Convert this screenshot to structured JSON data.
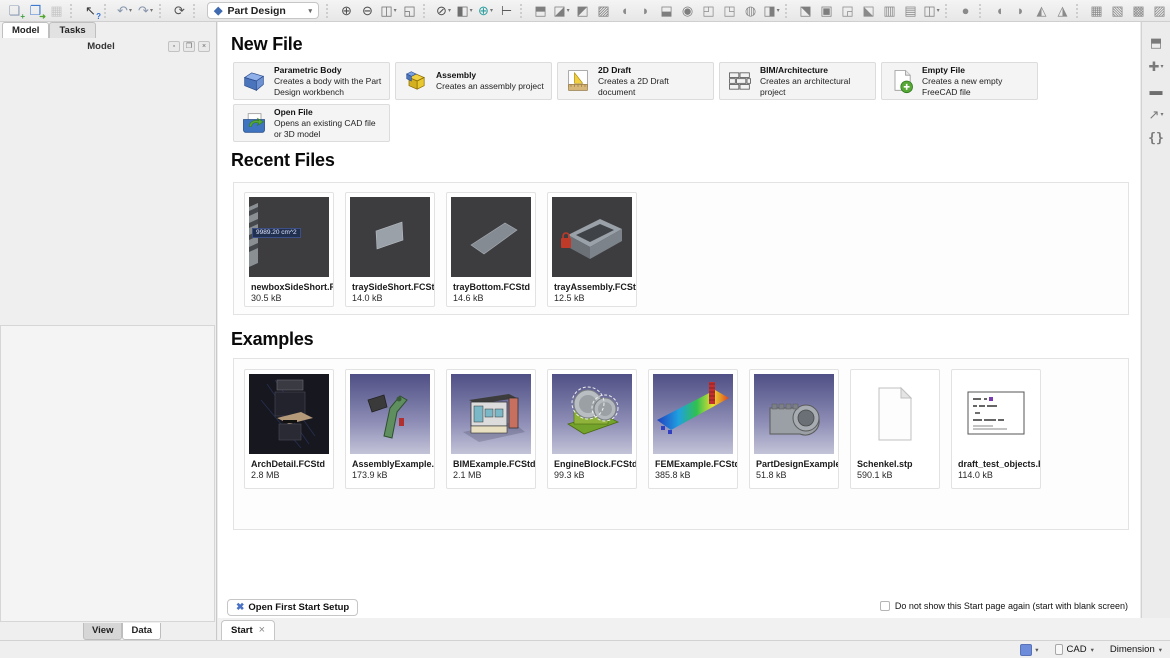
{
  "toolbar": {
    "workbench": "Part Design",
    "left_items": [
      {
        "name": "new-file",
        "glyph": "❏",
        "color": "#8d9cb5",
        "badge": "+",
        "badge_color": "#3f9e3f"
      },
      {
        "name": "open-file",
        "glyph": "❐",
        "color": "#3f7ad0",
        "badge": "➜",
        "badge_color": "#52a52f"
      },
      {
        "name": "save-file",
        "glyph": "▦",
        "color": "#a9a9a9",
        "disabled": true
      },
      {
        "sep": true
      },
      {
        "name": "whats-this",
        "glyph": "↖",
        "color": "#3a3a3a",
        "badge": "?",
        "badge_color": "#2f6fd0"
      },
      {
        "sep": true
      },
      {
        "name": "undo",
        "glyph": "↶",
        "color": "#8796ac",
        "dropdown": true
      },
      {
        "name": "redo",
        "glyph": "↷",
        "color": "#8796ac",
        "dropdown": true
      },
      {
        "sep": true
      },
      {
        "name": "refresh",
        "glyph": "⟳",
        "color": "#555555"
      },
      {
        "sep": true
      }
    ],
    "right_items": [
      {
        "name": "zoom-in",
        "glyph": "⊕",
        "color": "#4c4c4c"
      },
      {
        "name": "zoom-out",
        "glyph": "⊖",
        "color": "#4c4c4c"
      },
      {
        "name": "view-cube",
        "glyph": "◫",
        "color": "#6e6e6e",
        "dropdown": true
      },
      {
        "name": "fit-selection",
        "glyph": "◱",
        "color": "#6e6e6e"
      },
      {
        "sep": true
      },
      {
        "name": "draw-style",
        "glyph": "⊘",
        "color": "#4c4c4c",
        "dropdown": true
      },
      {
        "name": "std-views",
        "glyph": "◧",
        "color": "#6e6e6e",
        "dropdown": true
      },
      {
        "name": "zoom-tools",
        "glyph": "⊕",
        "color": "#2a9d9d",
        "dropdown": true
      },
      {
        "name": "measure",
        "glyph": "⊢",
        "color": "#5a5a5a"
      },
      {
        "sep": true
      },
      {
        "name": "create-body",
        "glyph": "⬒",
        "color": "#7e7e7e"
      },
      {
        "name": "create-sketch",
        "glyph": "◪",
        "color": "#7e7e7e",
        "dropdown": true
      },
      {
        "name": "edit-sketch",
        "glyph": "◩",
        "color": "#7e7e7e"
      },
      {
        "name": "validate-sketch",
        "glyph": "▨",
        "color": "#7e7e7e"
      },
      {
        "name": "shape-binder",
        "glyph": "◖",
        "color": "#8a8a8a"
      },
      {
        "name": "clone",
        "glyph": "◗",
        "color": "#8a8a8a"
      },
      {
        "name": "pad",
        "glyph": "⬓",
        "color": "#7e7e7e"
      },
      {
        "name": "revolution",
        "glyph": "◉",
        "color": "#7e7e7e"
      },
      {
        "name": "additive-loft",
        "glyph": "◰",
        "color": "#8a8a8a"
      },
      {
        "name": "additive-pipe",
        "glyph": "◳",
        "color": "#8a8a8a"
      },
      {
        "name": "additive-helix",
        "glyph": "◍",
        "color": "#8a8a8a"
      },
      {
        "name": "additive-primitive",
        "glyph": "◨",
        "color": "#7e7e7e",
        "dropdown": true
      },
      {
        "sep": true
      },
      {
        "name": "pocket",
        "glyph": "⬔",
        "color": "#7e7e7e"
      },
      {
        "name": "hole",
        "glyph": "▣",
        "color": "#7e7e7e"
      },
      {
        "name": "groove",
        "glyph": "◲",
        "color": "#8a8a8a"
      },
      {
        "name": "subtractive-loft",
        "glyph": "⬕",
        "color": "#8a8a8a"
      },
      {
        "name": "subtractive-pipe",
        "glyph": "▥",
        "color": "#8a8a8a"
      },
      {
        "name": "subtractive-helix",
        "glyph": "▤",
        "color": "#8a8a8a"
      },
      {
        "name": "subtractive-primitive",
        "glyph": "◫",
        "color": "#7e7e7e",
        "dropdown": true
      },
      {
        "sep": true
      },
      {
        "name": "boolean",
        "glyph": "●",
        "color": "#8a8a8a"
      },
      {
        "sep": true
      },
      {
        "name": "fillet",
        "glyph": "◖",
        "color": "#8a8a8a"
      },
      {
        "name": "chamfer",
        "glyph": "◗",
        "color": "#8a8a8a"
      },
      {
        "name": "draft-angle",
        "glyph": "◭",
        "color": "#8a8a8a"
      },
      {
        "name": "thickness",
        "glyph": "◮",
        "color": "#8a8a8a"
      },
      {
        "sep": true
      },
      {
        "name": "mirrored",
        "glyph": "▦",
        "color": "#8a8a8a"
      },
      {
        "name": "linear-pattern",
        "glyph": "▧",
        "color": "#8a8a8a"
      },
      {
        "name": "polar-pattern",
        "glyph": "▩",
        "color": "#8a8a8a"
      },
      {
        "name": "multi-transform",
        "glyph": "▨",
        "color": "#8a8a8a"
      }
    ]
  },
  "right_toolbar": {
    "icons": [
      {
        "name": "part-workbench",
        "glyph": "⬒",
        "color": "#7a7a7a"
      },
      {
        "name": "datum-tools",
        "glyph": "✚",
        "color": "#7a7a7a",
        "dropdown": true
      },
      {
        "name": "group",
        "glyph": "▬",
        "color": "#6e6e6e"
      },
      {
        "name": "link-actions",
        "glyph": "↗",
        "color": "#7a7a7a",
        "dropdown": true
      },
      {
        "name": "expression",
        "glyph": "{}",
        "color": "#7a7a7a",
        "mono": true
      }
    ]
  },
  "left_panel": {
    "tabs": [
      {
        "label": "Model"
      },
      {
        "label": "Tasks"
      }
    ],
    "header_title": "Model",
    "bottom_tabs": [
      {
        "label": "View"
      },
      {
        "label": "Data"
      }
    ]
  },
  "main": {
    "new_file": {
      "title": "New File",
      "cards": [
        {
          "title": "Parametric Body",
          "desc": "Creates a body with the Part Design workbench"
        },
        {
          "title": "Assembly",
          "desc": "Creates an assembly project"
        },
        {
          "title": "2D Draft",
          "desc": "Creates a 2D Draft document"
        },
        {
          "title": "BIM/Architecture",
          "desc": "Creates an architectural project"
        },
        {
          "title": "Empty File",
          "desc": "Creates a new empty FreeCAD file"
        },
        {
          "title": "Open File",
          "desc": "Opens an existing CAD file or 3D model"
        }
      ]
    },
    "recent": {
      "title": "Recent Files",
      "files": [
        {
          "name": "newboxSideShort.FC...",
          "size": "30.5 kB",
          "overlay": "9989.20 cm^2"
        },
        {
          "name": "traySideShort.FCStd",
          "size": "14.0 kB"
        },
        {
          "name": "trayBottom.FCStd",
          "size": "14.6 kB"
        },
        {
          "name": "trayAssembly.FCStd",
          "size": "12.5 kB"
        }
      ]
    },
    "examples": {
      "title": "Examples",
      "files": [
        {
          "name": "ArchDetail.FCStd",
          "size": "2.8 MB"
        },
        {
          "name": "AssemblyExample.F...",
          "size": "173.9 kB"
        },
        {
          "name": "BIMExample.FCStd",
          "size": "2.1 MB"
        },
        {
          "name": "EngineBlock.FCStd",
          "size": "99.3 kB"
        },
        {
          "name": "FEMExample.FCStd",
          "size": "385.8 kB"
        },
        {
          "name": "PartDesignExample....",
          "size": "51.8 kB"
        },
        {
          "name": "Schenkel.stp",
          "size": "590.1 kB"
        },
        {
          "name": "draft_test_objects.F...",
          "size": "114.0 kB"
        }
      ]
    },
    "first_start_button": "Open First Start Setup",
    "dont_show_label": "Do not show this Start page again (start with blank screen)",
    "tab_label": "Start"
  },
  "status_bar": {
    "cad_label": "CAD",
    "dimension_label": "Dimension"
  }
}
